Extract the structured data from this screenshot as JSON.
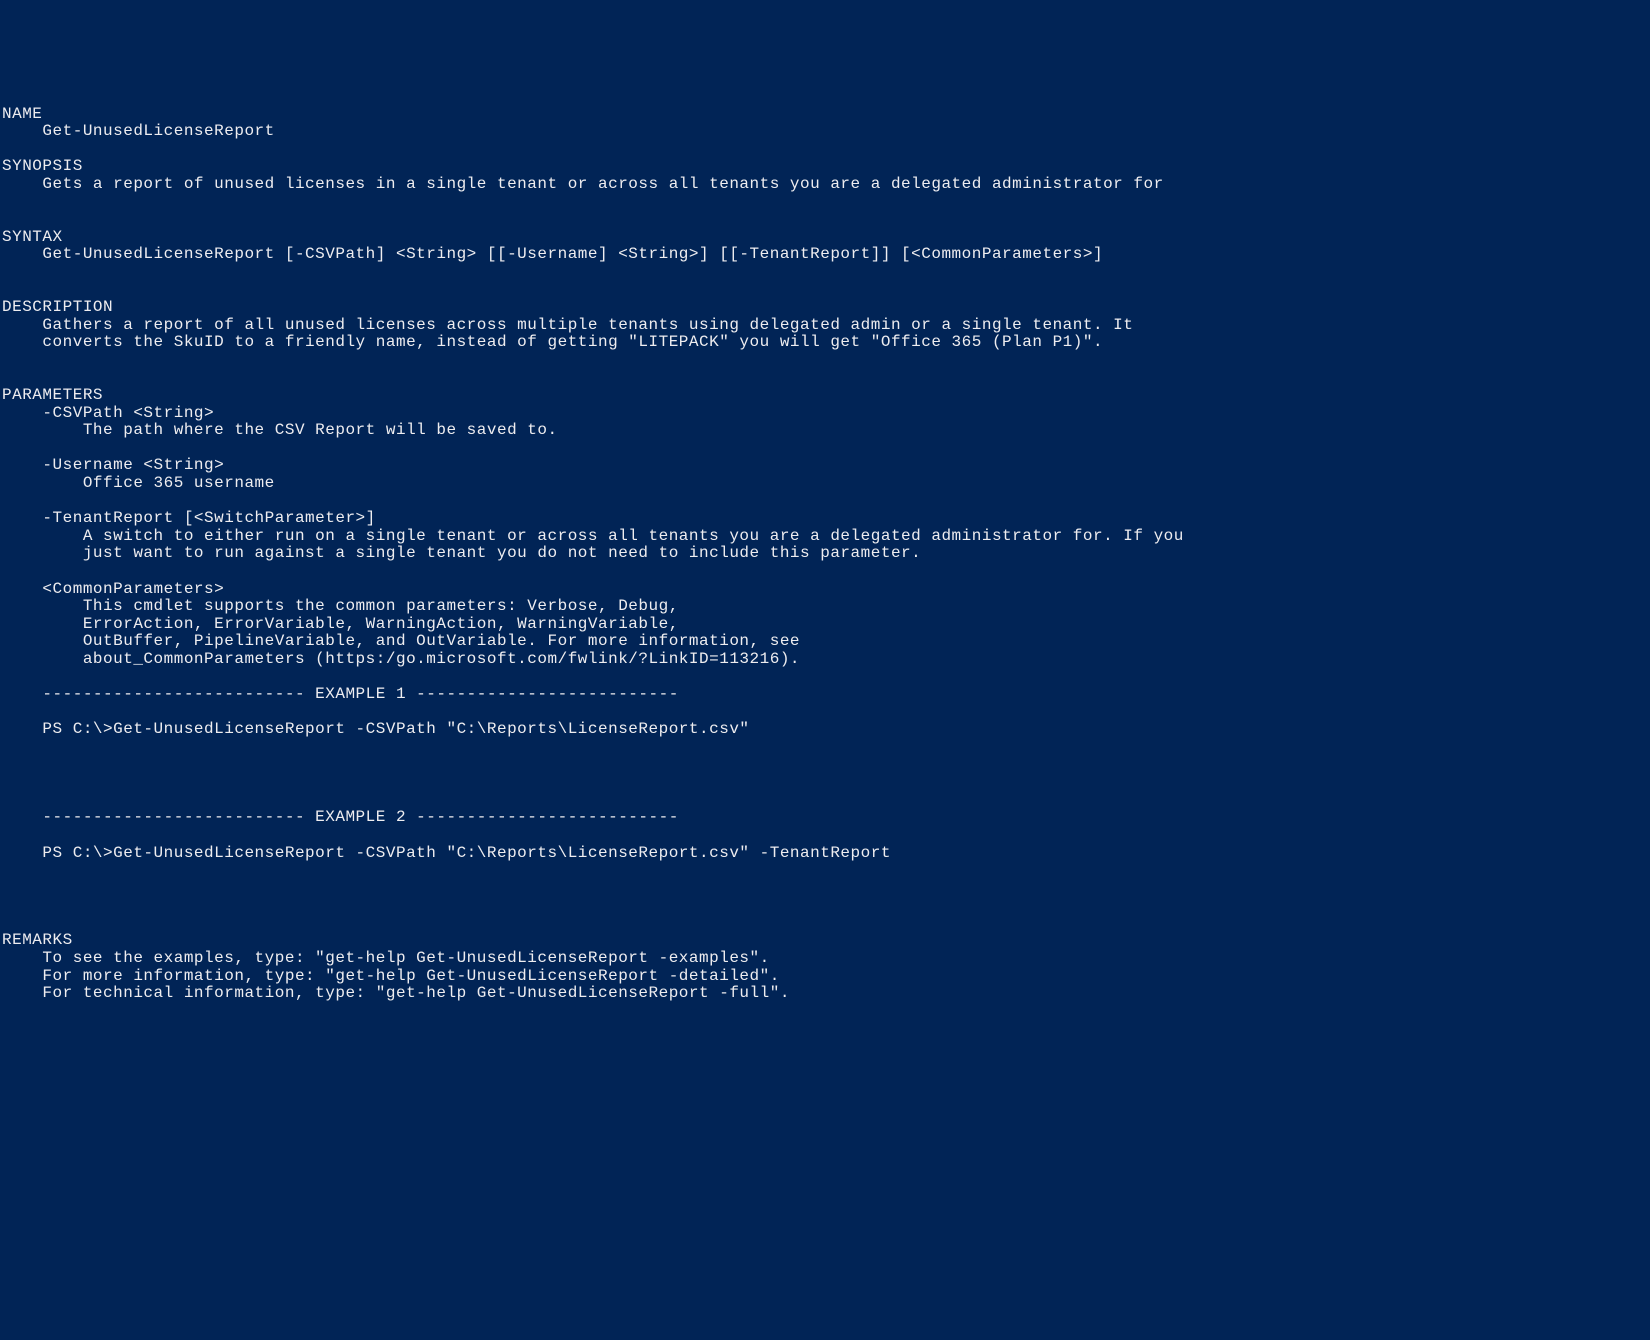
{
  "name_heading": "NAME",
  "name_value": "    Get-UnusedLicenseReport",
  "synopsis_heading": "SYNOPSIS",
  "synopsis_value": "    Gets a report of unused licenses in a single tenant or across all tenants you are a delegated administrator for",
  "syntax_heading": "SYNTAX",
  "syntax_value": "    Get-UnusedLicenseReport [-CSVPath] <String> [[-Username] <String>] [[-TenantReport]] [<CommonParameters>]",
  "description_heading": "DESCRIPTION",
  "description_line1": "    Gathers a report of all unused licenses across multiple tenants using delegated admin or a single tenant. It",
  "description_line2": "    converts the SkuID to a friendly name, instead of getting \"LITEPACK\" you will get \"Office 365 (Plan P1)\".",
  "parameters_heading": "PARAMETERS",
  "param1_name": "    -CSVPath <String>",
  "param1_desc": "        The path where the CSV Report will be saved to.",
  "param2_name": "    -Username <String>",
  "param2_desc": "        Office 365 username",
  "param3_name": "    -TenantReport [<SwitchParameter>]",
  "param3_desc_l1": "        A switch to either run on a single tenant or across all tenants you are a delegated administrator for. If you",
  "param3_desc_l2": "        just want to run against a single tenant you do not need to include this parameter.",
  "common_name": "    <CommonParameters>",
  "common_l1": "        This cmdlet supports the common parameters: Verbose, Debug,",
  "common_l2": "        ErrorAction, ErrorVariable, WarningAction, WarningVariable,",
  "common_l3": "        OutBuffer, PipelineVariable, and OutVariable. For more information, see",
  "common_l4": "        about_CommonParameters (https:/go.microsoft.com/fwlink/?LinkID=113216).",
  "example1_sep": "    -------------------------- EXAMPLE 1 --------------------------",
  "example1_cmd": "    PS C:\\>Get-UnusedLicenseReport -CSVPath \"C:\\Reports\\LicenseReport.csv\"",
  "example2_sep": "    -------------------------- EXAMPLE 2 --------------------------",
  "example2_cmd": "    PS C:\\>Get-UnusedLicenseReport -CSVPath \"C:\\Reports\\LicenseReport.csv\" -TenantReport",
  "remarks_heading": "REMARKS",
  "remarks_l1": "    To see the examples, type: \"get-help Get-UnusedLicenseReport -examples\".",
  "remarks_l2": "    For more information, type: \"get-help Get-UnusedLicenseReport -detailed\".",
  "remarks_l3": "    For technical information, type: \"get-help Get-UnusedLicenseReport -full\"."
}
